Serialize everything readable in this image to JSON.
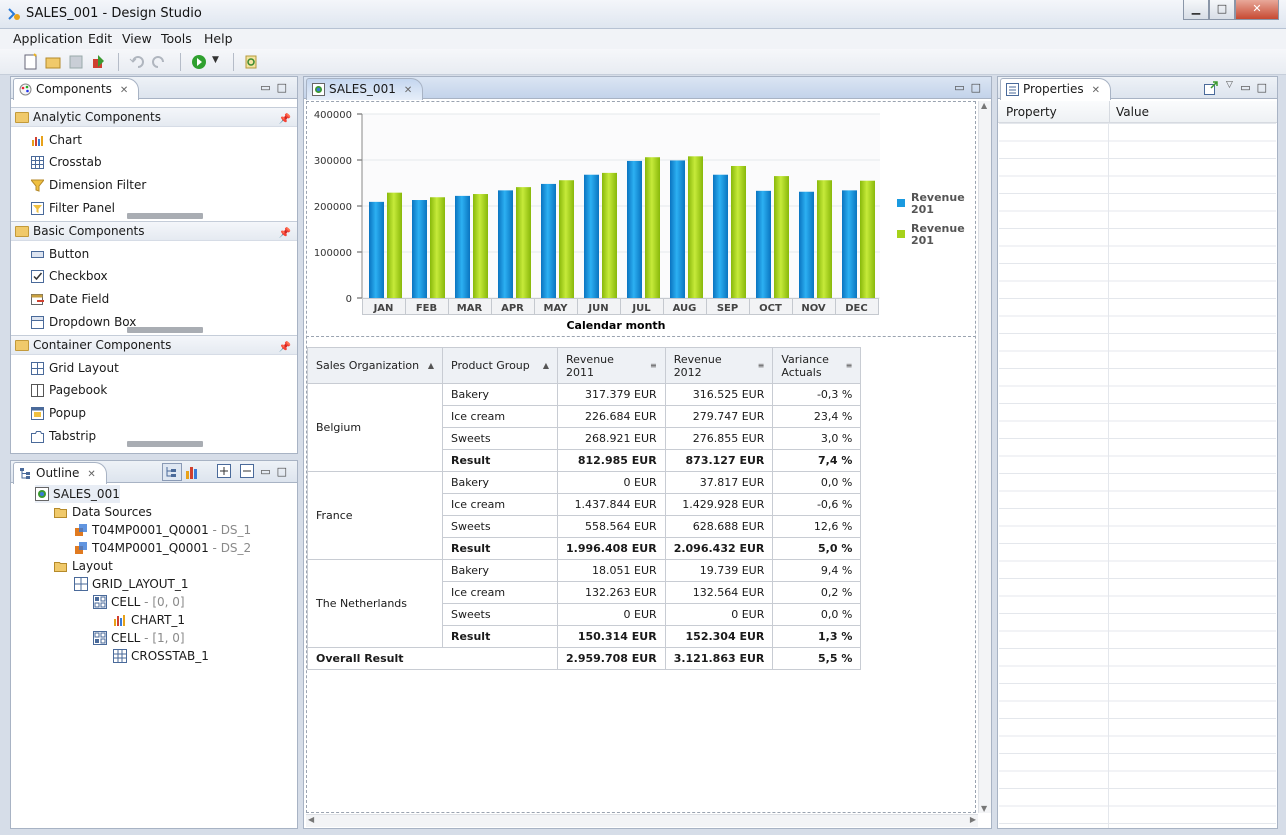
{
  "window": {
    "title": "SALES_001 - Design Studio",
    "min": "▁",
    "max": "□",
    "close": "✕"
  },
  "menu": [
    "Application",
    "Edit",
    "View",
    "Tools",
    "Help"
  ],
  "components_panel": {
    "tab": "Components",
    "sections": [
      {
        "title": "Analytic Components",
        "items": [
          {
            "label": "Chart",
            "icon": "chart-icon"
          },
          {
            "label": "Crosstab",
            "icon": "crosstab-icon"
          },
          {
            "label": "Dimension Filter",
            "icon": "filter-icon"
          },
          {
            "label": "Filter Panel",
            "icon": "filter-panel-icon"
          }
        ]
      },
      {
        "title": "Basic Components",
        "items": [
          {
            "label": "Button",
            "icon": "button-icon"
          },
          {
            "label": "Checkbox",
            "icon": "checkbox-icon"
          },
          {
            "label": "Date Field",
            "icon": "date-field-icon"
          },
          {
            "label": "Dropdown Box",
            "icon": "dropdown-icon"
          }
        ]
      },
      {
        "title": "Container Components",
        "items": [
          {
            "label": "Grid Layout",
            "icon": "grid-icon"
          },
          {
            "label": "Pagebook",
            "icon": "pagebook-icon"
          },
          {
            "label": "Popup",
            "icon": "popup-icon"
          },
          {
            "label": "Tabstrip",
            "icon": "tabstrip-icon"
          }
        ]
      }
    ]
  },
  "outline": {
    "tab": "Outline",
    "root": "SALES_001",
    "data_sources": "Data Sources",
    "ds1": {
      "name": "T04MP0001_Q0001",
      "alias": "- DS_1"
    },
    "ds2": {
      "name": "T04MP0001_Q0001",
      "alias": "- DS_2"
    },
    "layout": "Layout",
    "grid": "GRID_LAYOUT_1",
    "cell1": {
      "name": "CELL",
      "pos": "- [0, 0]"
    },
    "chart": "CHART_1",
    "cell2": {
      "name": "CELL",
      "pos": "- [1, 0]"
    },
    "crosstab": "CROSSTAB_1"
  },
  "editor": {
    "tab": "SALES_001"
  },
  "chart_data": {
    "type": "bar",
    "categories": [
      "JAN",
      "FEB",
      "MAR",
      "APR",
      "MAY",
      "JUN",
      "JUL",
      "AUG",
      "SEP",
      "OCT",
      "NOV",
      "DEC"
    ],
    "series": [
      {
        "name": "Revenue 201",
        "color": "#1a9ae0",
        "values": [
          209000,
          213000,
          222000,
          234000,
          248000,
          268000,
          298000,
          299000,
          268000,
          233000,
          231000,
          234000
        ]
      },
      {
        "name": "Revenue 201",
        "color": "#a6d21a",
        "values": [
          229000,
          219000,
          226000,
          241000,
          256000,
          272000,
          306000,
          308000,
          287000,
          265000,
          256000,
          255000
        ]
      }
    ],
    "yticks": [
      "0",
      "100000",
      "200000",
      "300000",
      "400000"
    ],
    "ylim": [
      0,
      400000
    ],
    "xlabel": "Calendar month",
    "legend": [
      "Revenue",
      "201",
      "Revenue",
      "201"
    ]
  },
  "crosstab": {
    "headers": [
      "Sales Organization",
      "Product Group",
      "Revenue 2011",
      "Revenue 2012",
      "Variance Actuals"
    ],
    "header_lines": [
      [
        "Sales Organization"
      ],
      [
        "Product Group"
      ],
      [
        "Revenue",
        "2011"
      ],
      [
        "Revenue",
        "2012"
      ],
      [
        "Variance",
        "Actuals"
      ]
    ],
    "groups": [
      {
        "org": "Belgium",
        "rows": [
          [
            "Bakery",
            "317.379 EUR",
            "316.525 EUR",
            "-0,3 %"
          ],
          [
            "Ice cream",
            "226.684 EUR",
            "279.747 EUR",
            "23,4 %"
          ],
          [
            "Sweets",
            "268.921 EUR",
            "276.855 EUR",
            "3,0 %"
          ],
          [
            "Result",
            "812.985 EUR",
            "873.127 EUR",
            "7,4 %"
          ]
        ]
      },
      {
        "org": "France",
        "rows": [
          [
            "Bakery",
            "0 EUR",
            "37.817 EUR",
            "0,0 %"
          ],
          [
            "Ice cream",
            "1.437.844 EUR",
            "1.429.928 EUR",
            "-0,6 %"
          ],
          [
            "Sweets",
            "558.564 EUR",
            "628.688 EUR",
            "12,6 %"
          ],
          [
            "Result",
            "1.996.408 EUR",
            "2.096.432 EUR",
            "5,0 %"
          ]
        ]
      },
      {
        "org": "The Netherlands",
        "rows": [
          [
            "Bakery",
            "18.051 EUR",
            "19.739 EUR",
            "9,4 %"
          ],
          [
            "Ice cream",
            "132.263 EUR",
            "132.564 EUR",
            "0,2 %"
          ],
          [
            "Sweets",
            "0 EUR",
            "0 EUR",
            "0,0 %"
          ],
          [
            "Result",
            "150.314 EUR",
            "152.304 EUR",
            "1,3 %"
          ]
        ]
      }
    ],
    "overall": [
      "Overall Result",
      "2.959.708 EUR",
      "3.121.863 EUR",
      "5,5 %"
    ]
  },
  "properties": {
    "tab": "Properties",
    "col_property": "Property",
    "col_value": "Value"
  }
}
